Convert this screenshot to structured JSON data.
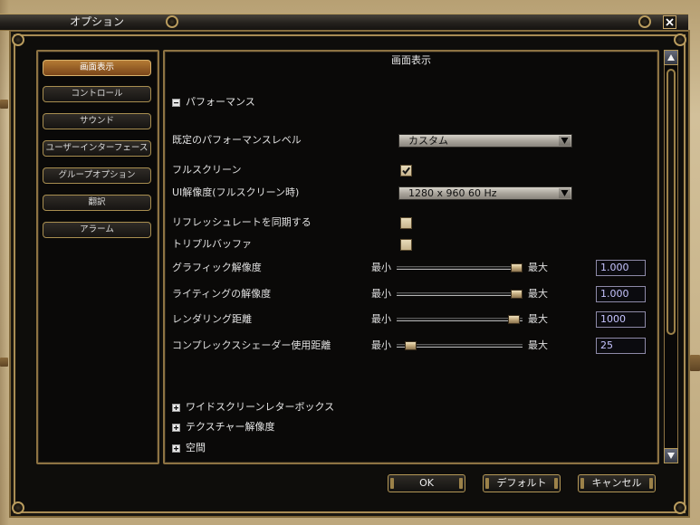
{
  "window": {
    "title": "オプション",
    "close_icon": "close-icon"
  },
  "sidebar": {
    "items": [
      {
        "label": "画面表示",
        "selected": true
      },
      {
        "label": "コントロール",
        "selected": false
      },
      {
        "label": "サウンド",
        "selected": false
      },
      {
        "label": "ユーザーインターフェース",
        "selected": false
      },
      {
        "label": "グループオプション",
        "selected": false
      },
      {
        "label": "翻訳",
        "selected": false
      },
      {
        "label": "アラーム",
        "selected": false
      }
    ]
  },
  "panel": {
    "title": "画面表示"
  },
  "performance": {
    "header": {
      "label": "パフォーマンス",
      "expanded": true,
      "icon": "collapse-icon"
    },
    "performance_level": {
      "label": "既定のパフォーマンスレベル",
      "value": "カスタム",
      "icon": "dropdown-arrow-icon"
    },
    "fullscreen": {
      "label": "フルスクリーン",
      "checked": true
    },
    "resolution": {
      "label": "UI解像度(フルスクリーン時)",
      "value": "1280 x 960 60 Hz",
      "icon": "dropdown-arrow-icon"
    },
    "vsync": {
      "label": "リフレッシュレートを同期する",
      "checked": false
    },
    "triple_buffer": {
      "label": "トリプルバッファ",
      "checked": false
    },
    "sliders": [
      {
        "label": "グラフィック解像度",
        "min_label": "最小",
        "max_label": "最大",
        "level": 1.0,
        "value": "1.000"
      },
      {
        "label": "ライティングの解像度",
        "min_label": "最小",
        "max_label": "最大",
        "level": 1.0,
        "value": "1.000"
      },
      {
        "label": "レンダリング距離",
        "min_label": "最小",
        "max_label": "最大",
        "level": 0.98,
        "value": "1000"
      },
      {
        "label": "コンプレックスシェーダー使用距離",
        "min_label": "最小",
        "max_label": "最大",
        "level": 0.07,
        "value": "25"
      }
    ]
  },
  "collapsed_sections": [
    {
      "label": "ワイドスクリーンレターボックス",
      "expanded": false,
      "icon": "expand-icon"
    },
    {
      "label": "テクスチャー解像度",
      "expanded": false,
      "icon": "expand-icon"
    },
    {
      "label": "空間",
      "expanded": false,
      "icon": "expand-icon"
    }
  ],
  "scrollbar": {
    "up_icon": "scroll-up-arrow-icon",
    "down_icon": "scroll-down-arrow-icon"
  },
  "buttons": {
    "ok": "OK",
    "default": "デフォルト",
    "cancel": "キャンセル"
  },
  "colors": {
    "frame_gold": "#a88c54",
    "selected_tab": "#7a461a",
    "value_text": "#c6c4ff"
  }
}
